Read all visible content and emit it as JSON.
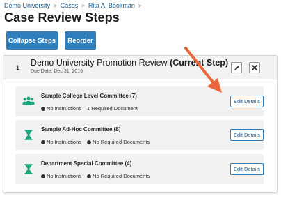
{
  "breadcrumb": {
    "items": [
      "Demo University",
      "Cases",
      "Rita A. Bookman"
    ],
    "separator": ">"
  },
  "page": {
    "title": "Case Review Steps"
  },
  "toolbar": {
    "collapse_label": "Collapse Steps",
    "reorder_label": "Reorder"
  },
  "step": {
    "number": "1",
    "title": "Demo University Promotion Review",
    "status": "(Current Step)",
    "due_date": "Due Date: Dec 31, 2016"
  },
  "committees": [
    {
      "title": "Sample College Level Committee (7)",
      "icon": "group-icon",
      "instructions": "No Instructions",
      "documents": "1 Required Document",
      "button": "Edit Details"
    },
    {
      "title": "Sample Ad-Hoc Committee (8)",
      "icon": "hourglass-icon",
      "instructions": "No Instructions",
      "documents": "No Required Documents",
      "button": "Edit Details"
    },
    {
      "title": "Department Special Committee (4)",
      "icon": "hourglass-icon",
      "instructions": "No Instructions",
      "documents": "No Required Documents",
      "button": "Edit Details"
    }
  ],
  "colors": {
    "primary": "#2f7fbd",
    "icon_green": "#1aa37a",
    "annotation_arrow": "#e8663a"
  }
}
